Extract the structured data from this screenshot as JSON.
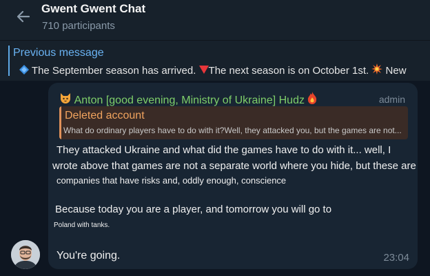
{
  "header": {
    "title": "Gwent Gwent Chat",
    "participants": "710 participants"
  },
  "pinned": {
    "label": "Previous message",
    "text": "The September season has arrived. ",
    "text2": "The next season is on October 1st. ",
    "text3": "New"
  },
  "message": {
    "sender": "Anton [good evening, Ministry of Ukraine] Hudz",
    "role": "admin",
    "reply": {
      "title": "Deleted account",
      "text": "What do ordinary players have to do with it?Well, they attacked you, but the games are not..."
    },
    "lines": [
      "They attacked Ukraine and what did the games have to do with it... well, I",
      "wrote above that games are not a separate world where you hide, but these are",
      "companies that have risks and, oddly enough, conscience",
      "Because today you are a player, and tomorrow you will go to",
      "Poland with tanks.",
      "You're going."
    ],
    "time": "23:04"
  },
  "icons": [
    "back-arrow-icon",
    "blue-diamond-icon",
    "red-triangle-icon",
    "collision-icon",
    "cat-face-icon",
    "fire-icon"
  ],
  "colors": {
    "background": "#0e1621",
    "header": "#17212b",
    "bubble": "#182533",
    "link": "#6ab3f3",
    "sender": "#7fcf6a",
    "reply_accent": "#f0a35e"
  }
}
